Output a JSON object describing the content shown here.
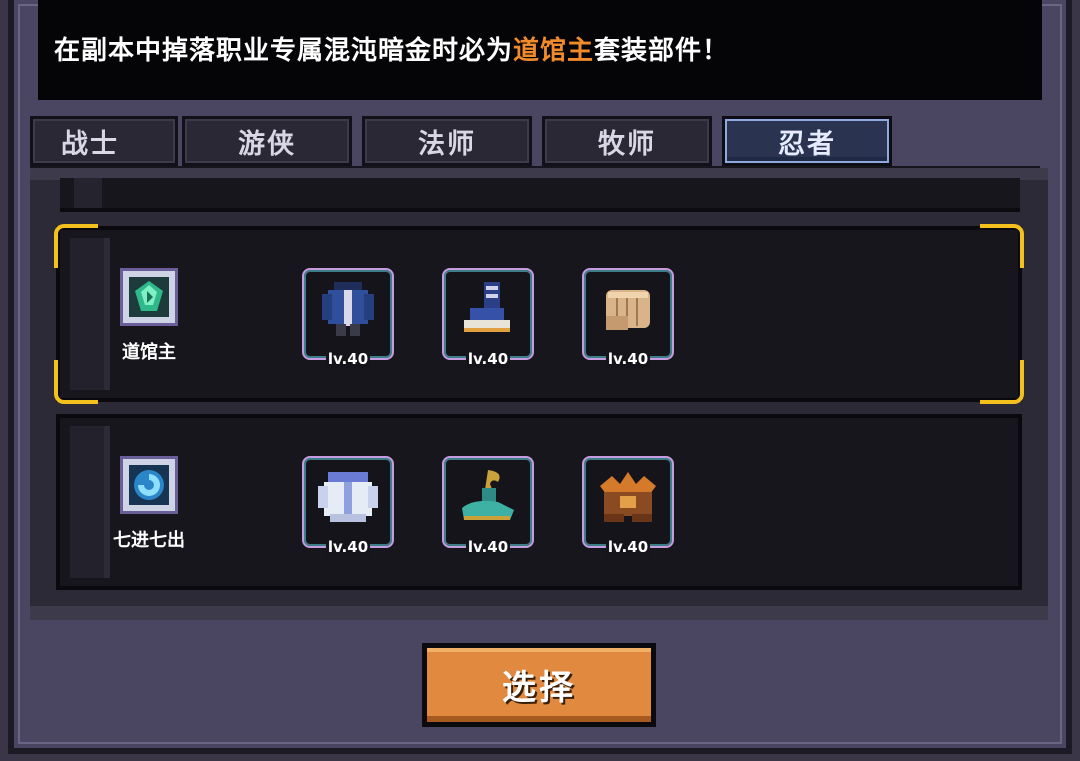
{
  "notice": {
    "prefix": "在副本中掉落职业专属混沌暗金时必为",
    "highlight": "道馆主",
    "suffix": "套装部件！"
  },
  "tabs": [
    {
      "label": "战士",
      "active": false
    },
    {
      "label": "游侠",
      "active": false
    },
    {
      "label": "法师",
      "active": false
    },
    {
      "label": "牧师",
      "active": false
    },
    {
      "label": "忍者",
      "active": true
    }
  ],
  "sets": [
    {
      "name": "道馆主",
      "selected": true,
      "icon": "green-gem-icon",
      "items": [
        {
          "icon": "blue-armor-icon",
          "level": "lv.40"
        },
        {
          "icon": "blue-boots-icon",
          "level": "lv.40"
        },
        {
          "icon": "fist-gauntlet-icon",
          "level": "lv.40"
        }
      ]
    },
    {
      "name": "七进七出",
      "selected": false,
      "icon": "blue-swirl-gem-icon",
      "items": [
        {
          "icon": "white-armor-icon",
          "level": "lv.40"
        },
        {
          "icon": "teal-boots-icon",
          "level": "lv.40"
        },
        {
          "icon": "bronze-crown-icon",
          "level": "lv.40"
        }
      ]
    }
  ],
  "select_button": {
    "label": "选择"
  },
  "colors": {
    "highlight": "#f08a2a",
    "selection": "#f4c01e",
    "button": "#e0893f"
  }
}
